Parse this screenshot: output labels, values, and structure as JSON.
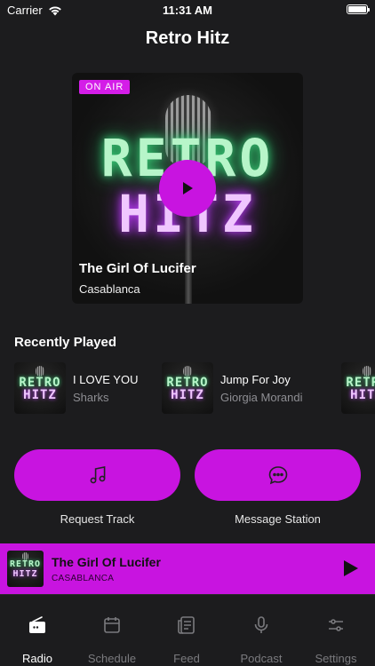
{
  "status_bar": {
    "carrier": "Carrier",
    "time": "11:31 AM"
  },
  "app": {
    "title": "Retro Hitz"
  },
  "hero": {
    "badge": "ON AIR",
    "art_top": "RETRO",
    "art_bottom": "HITZ",
    "song": "The Girl Of Lucifer",
    "artist": "Casablanca"
  },
  "recent": {
    "title": "Recently Played",
    "items": [
      {
        "title": "I LOVE YOU",
        "artist": "Sharks",
        "art_top": "RETRO",
        "art_bottom": "HITZ"
      },
      {
        "title": "Jump For Joy",
        "artist": "Giorgia Morandi",
        "art_top": "RETRO",
        "art_bottom": "HITZ"
      },
      {
        "title": "",
        "artist": "",
        "art_top": "RETRO",
        "art_bottom": "HITZ"
      }
    ]
  },
  "actions": {
    "request": {
      "label": "Request Track",
      "icon": "music-note-icon"
    },
    "message": {
      "label": "Message Station",
      "icon": "chat-bubble-icon"
    }
  },
  "mini_player": {
    "title": "The Girl Of Lucifer",
    "artist": "CASABLANCA",
    "art_top": "RETRO",
    "art_bottom": "HITZ"
  },
  "tabs": [
    {
      "label": "Radio",
      "icon": "radio-icon",
      "active": true
    },
    {
      "label": "Schedule",
      "icon": "calendar-icon",
      "active": false
    },
    {
      "label": "Feed",
      "icon": "news-icon",
      "active": false
    },
    {
      "label": "Podcast",
      "icon": "microphone-icon",
      "active": false
    },
    {
      "label": "Settings",
      "icon": "sliders-icon",
      "active": false
    }
  ],
  "colors": {
    "accent": "#c814e0",
    "background": "#1c1c1e",
    "inactive_tab": "#7a7a7e"
  }
}
